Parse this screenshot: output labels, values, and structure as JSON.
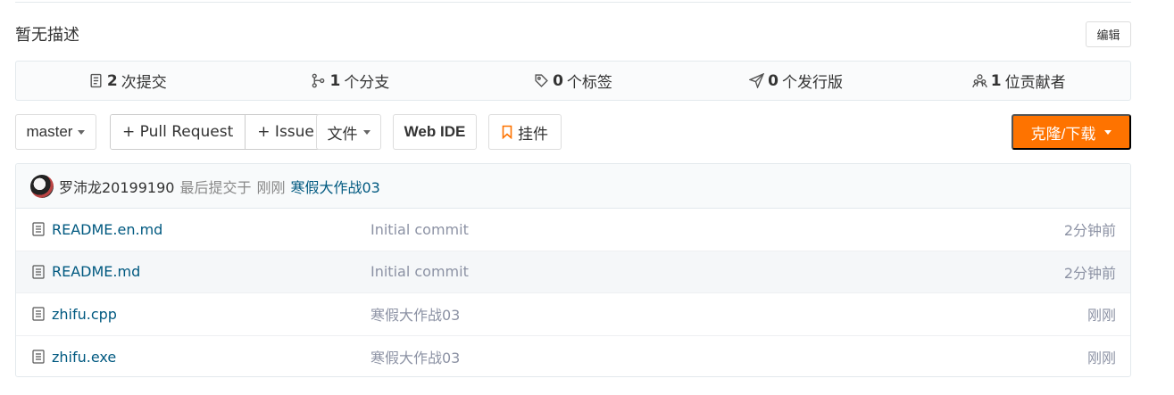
{
  "repo": {
    "description": "暂无描述",
    "edit_label": "编辑"
  },
  "stats": [
    {
      "icon": "commit-icon",
      "count": "2",
      "label": "次提交"
    },
    {
      "icon": "branch-icon",
      "count": "1",
      "label": "个分支"
    },
    {
      "icon": "tag-icon",
      "count": "0",
      "label": "个标签"
    },
    {
      "icon": "release-icon",
      "count": "0",
      "label": "个发行版"
    },
    {
      "icon": "contributors-icon",
      "count": "1",
      "label": "位贡献者"
    }
  ],
  "toolbar": {
    "branch": "master",
    "pull_request": "+ Pull Request",
    "issue": "+ Issue",
    "files": "文件",
    "web_ide": "Web IDE",
    "widget": "挂件",
    "clone": "克隆/下载"
  },
  "last_commit": {
    "author": "罗沛龙20199190",
    "text": "最后提交于",
    "time": "刚刚",
    "message": "寒假大作战03"
  },
  "files": [
    {
      "name": "README.en.md",
      "message": "Initial commit",
      "time": "2分钟前"
    },
    {
      "name": "README.md",
      "message": "Initial commit",
      "time": "2分钟前"
    },
    {
      "name": "zhifu.cpp",
      "message": "寒假大作战03",
      "time": "刚刚"
    },
    {
      "name": "zhifu.exe",
      "message": "寒假大作战03",
      "time": "刚刚"
    }
  ],
  "colors": {
    "accent": "#fe7300",
    "link": "#005980"
  }
}
